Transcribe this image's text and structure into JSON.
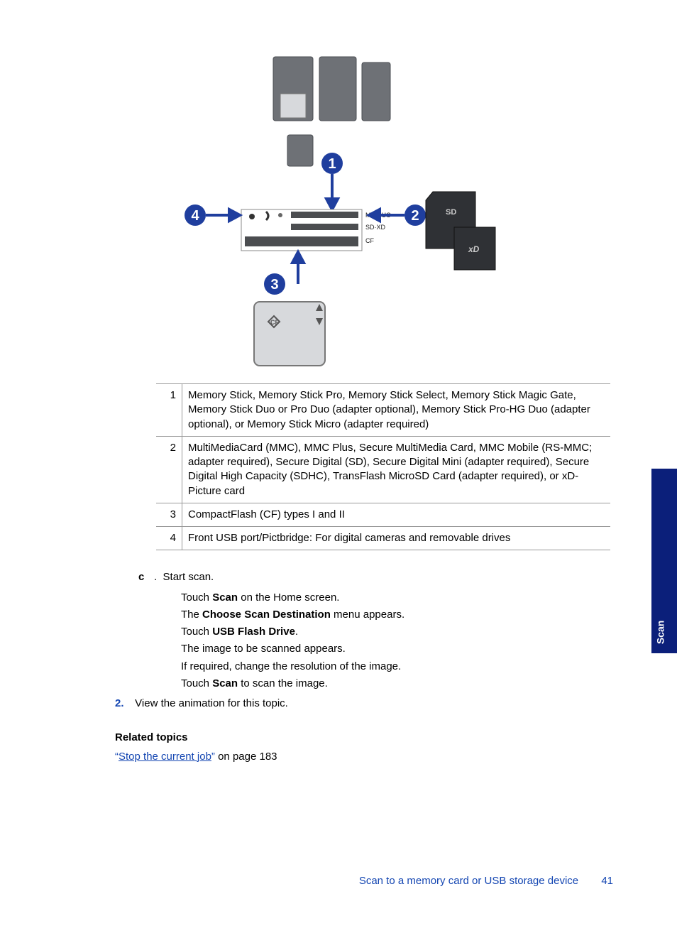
{
  "diagram": {
    "callouts": [
      "1",
      "2",
      "3",
      "4"
    ],
    "slot_labels": {
      "ms": "MS/DUO",
      "sd": "SD·XD",
      "cf": "CF"
    },
    "icons": {
      "sd_text": "SD",
      "xd_text": "xD",
      "cf_text": "CF"
    }
  },
  "legend": [
    {
      "num": "1",
      "text": "Memory Stick, Memory Stick Pro, Memory Stick Select, Memory Stick Magic Gate, Memory Stick Duo or Pro Duo (adapter optional), Memory Stick Pro-HG Duo (adapter optional), or Memory Stick Micro (adapter required)"
    },
    {
      "num": "2",
      "text": "MultiMediaCard (MMC), MMC Plus, Secure MultiMedia Card, MMC Mobile (RS-MMC; adapter required), Secure Digital (SD), Secure Digital Mini (adapter required), Secure Digital High Capacity (SDHC), TransFlash MicroSD Card (adapter required), or xD-Picture card"
    },
    {
      "num": "3",
      "text": "CompactFlash (CF) types I and II"
    },
    {
      "num": "4",
      "text": "Front USB port/Pictbridge: For digital cameras and removable drives"
    }
  ],
  "steps": {
    "c": {
      "label": "c",
      "title": "Start scan.",
      "lines": {
        "l1_pre": "Touch ",
        "l1_b": "Scan",
        "l1_post": " on the Home screen.",
        "l2_pre": "The ",
        "l2_b": "Choose Scan Destination",
        "l2_post": " menu appears.",
        "l3_pre": "Touch ",
        "l3_b": "USB Flash Drive",
        "l3_post": ".",
        "l4": "The image to be scanned appears.",
        "l5": "If required, change the resolution of the image.",
        "l6_pre": "Touch ",
        "l6_b": "Scan",
        "l6_post": " to scan the image."
      }
    },
    "s2": {
      "num": "2.",
      "text": "View the animation for this topic."
    }
  },
  "related": {
    "heading": "Related topics",
    "link_quote_open": "“",
    "link_text": "Stop the current job",
    "link_quote_close": "”",
    "link_suffix": " on page 183"
  },
  "sidetab": "Scan",
  "footer": {
    "section": "Scan to a memory card or USB storage device",
    "page": "41"
  }
}
